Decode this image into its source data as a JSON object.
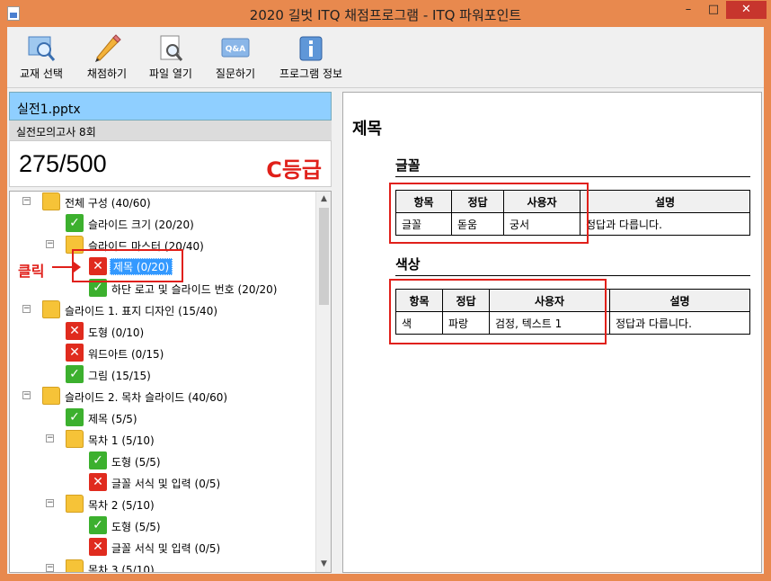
{
  "window": {
    "title": "2020 길벗 ITQ 채점프로그램 - ITQ 파워포인트",
    "min": "–",
    "max": "□",
    "close": "✕"
  },
  "toolbar": {
    "buttons": [
      {
        "label": "교재 선택",
        "icon": "book-search-icon"
      },
      {
        "label": "채점하기",
        "icon": "pencil-icon"
      },
      {
        "label": "파일 열기",
        "icon": "file-search-icon"
      },
      {
        "label": "질문하기",
        "icon": "qa-icon"
      },
      {
        "label": "프로그램 정보",
        "icon": "info-icon"
      }
    ]
  },
  "left": {
    "file_name": "실전1.pptx",
    "exam_name": "실전모의고사 8회",
    "score": "275/500",
    "grade": "C등급",
    "click_label": "클릭"
  },
  "tree": [
    {
      "label": "전체 구성 (40/60)",
      "type": "folder",
      "toggle": "−"
    },
    {
      "label": "슬라이드 크기 (20/20)",
      "type": "check"
    },
    {
      "label": "슬라이드 마스터 (20/40)",
      "type": "folder",
      "toggle": "−"
    },
    {
      "label": "제목 (0/20)",
      "type": "x"
    },
    {
      "label": "하단 로고 및 슬라이드 번호 (20/20)",
      "type": "check"
    },
    {
      "label": "슬라이드 1. 표지 디자인 (15/40)",
      "type": "folder",
      "toggle": "−"
    },
    {
      "label": "도형 (0/10)",
      "type": "x"
    },
    {
      "label": "워드아트 (0/15)",
      "type": "x"
    },
    {
      "label": "그림 (15/15)",
      "type": "check"
    },
    {
      "label": "슬라이드 2. 목차 슬라이드 (40/60)",
      "type": "folder",
      "toggle": "−"
    },
    {
      "label": "제목 (5/5)",
      "type": "check"
    },
    {
      "label": "목차 1 (5/10)",
      "type": "folder",
      "toggle": "−"
    },
    {
      "label": "도형 (5/5)",
      "type": "check"
    },
    {
      "label": "글꼴 서식 및 입력 (0/5)",
      "type": "x"
    },
    {
      "label": "목차 2 (5/10)",
      "type": "folder",
      "toggle": "−"
    },
    {
      "label": "도형 (5/5)",
      "type": "check"
    },
    {
      "label": "글꼴 서식 및 입력 (0/5)",
      "type": "x"
    },
    {
      "label": "목차 3 (5/10)",
      "type": "folder",
      "toggle": "−"
    }
  ],
  "detail": {
    "title": "제목",
    "font_section": {
      "title": "글꼴",
      "headers": [
        "항목",
        "정답",
        "사용자",
        "설명"
      ],
      "row": [
        "글꼴",
        "돋움",
        "궁서",
        "정답과 다릅니다."
      ]
    },
    "color_section": {
      "title": "색상",
      "headers": [
        "항목",
        "정답",
        "사용자",
        "설명"
      ],
      "row": [
        "색",
        "파랑",
        "검정, 텍스트 1",
        "정답과 다릅니다."
      ]
    }
  },
  "colors": {
    "accent": "#e0201a",
    "frame": "#e8894e",
    "selection": "#3399ff",
    "file_header": "#8fcfff"
  }
}
